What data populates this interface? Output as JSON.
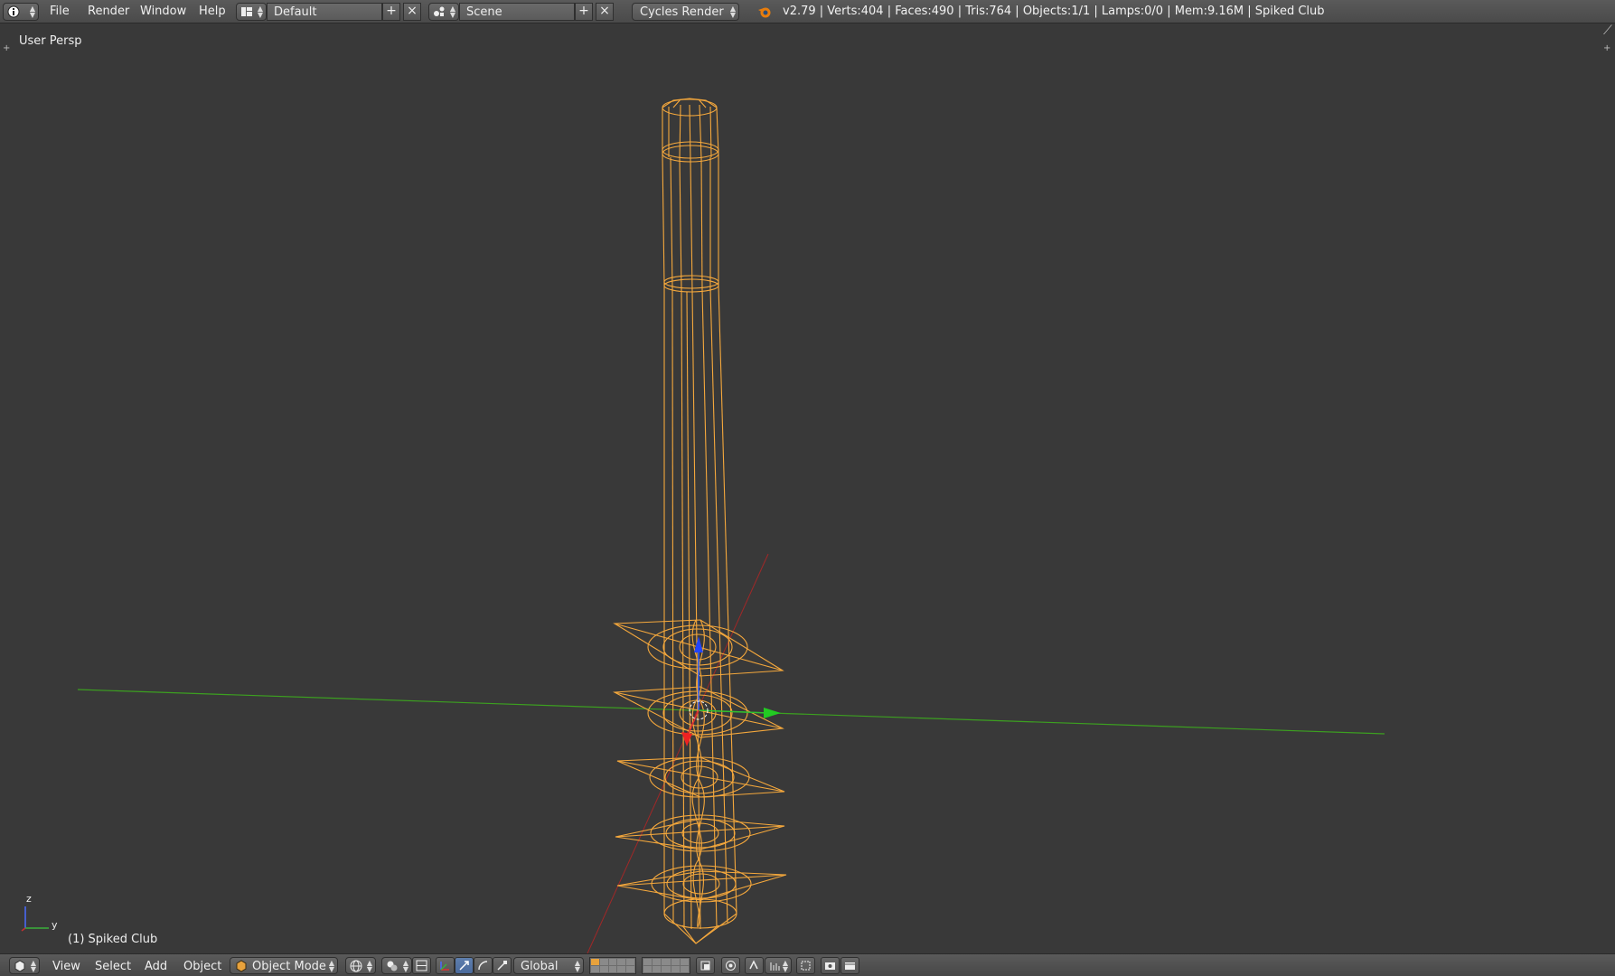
{
  "topbar": {
    "editor_type_icon": "info-icon",
    "menus": [
      "File",
      "Render",
      "Window",
      "Help"
    ],
    "screen_layout_icon": "screen-layout-icon",
    "screen_layout": "Default",
    "scene_icon": "scene-icon",
    "scene": "Scene",
    "render_engine": "Cycles Render",
    "blender_logo_icon": "blender-logo-icon",
    "status": "v2.79 | Verts:404 | Faces:490 | Tris:764 | Objects:1/1 | Lamps:0/0 | Mem:9.16M | Spiked Club"
  },
  "viewport": {
    "view_name": "User Persp",
    "object_info": "(1) Spiked Club",
    "axis_labels": {
      "z": "z",
      "y": "y"
    },
    "colors": {
      "wire": "#f5a83c",
      "y_axis": "#3ca020",
      "x_axis": "#a02828",
      "background": "#393939"
    }
  },
  "bottombar": {
    "editor_icon": "3d-view-icon",
    "menus": [
      "View",
      "Select",
      "Add",
      "Object"
    ],
    "mode": "Object Mode",
    "mode_icon": "object-mode-cube-icon",
    "viewport_shading_icon": "viewport-shading-icon",
    "pivot_icon": "pivot-point-icon",
    "manipulator_icons": [
      "manipulator-toggle-icon",
      "translate-icon",
      "rotate-icon",
      "scale-icon"
    ],
    "orientation": "Global",
    "extra_icons": [
      "lock-layers-icon",
      "proportional-edit-icon",
      "snap-icon",
      "snap-target-icon",
      "opengl-render-icon",
      "opengl-anim-icon"
    ]
  }
}
